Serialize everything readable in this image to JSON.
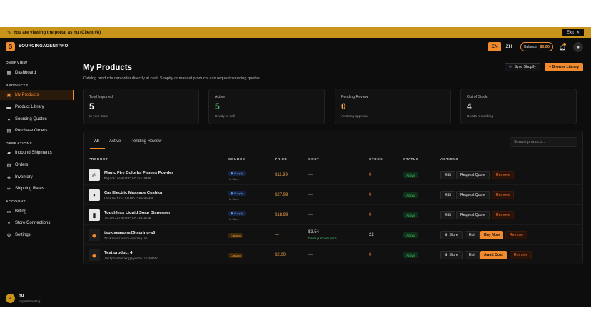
{
  "banner": {
    "text": "You are viewing the portal as hu (Client #8)",
    "exit_label": "Exit"
  },
  "brand": {
    "logo_letter": "S",
    "name": "SOURCINGAGENTPRO"
  },
  "topbar": {
    "lang_en": "EN",
    "lang_zh": "ZH",
    "balance_label": "Balance",
    "balance_value": "$0.00"
  },
  "sidebar": {
    "sections": [
      {
        "label": "OVERVIEW"
      },
      {
        "label": "PRODUCTS"
      },
      {
        "label": "OPERATIONS"
      },
      {
        "label": "ACCOUNT"
      }
    ],
    "items": [
      {
        "label": "Dashboard"
      },
      {
        "label": "My Products"
      },
      {
        "label": "Product Library"
      },
      {
        "label": "Sourcing Quotes"
      },
      {
        "label": "Purchase Orders"
      },
      {
        "label": "Inbound Shipments"
      },
      {
        "label": "Orders"
      },
      {
        "label": "Inventory"
      },
      {
        "label": "Shipping Rates"
      },
      {
        "label": "Billing"
      },
      {
        "label": "Store Connections"
      },
      {
        "label": "Settings"
      }
    ],
    "user": {
      "initial": "✓",
      "name": "hu",
      "role": "Impersonating"
    }
  },
  "page": {
    "title": "My Products",
    "subtitle": "Catalog products can order directly at cost. Shopify or manual products can request sourcing quotes.",
    "sync_label": "Sync Shopify",
    "browse_label": "+ Browse Library"
  },
  "stats": [
    {
      "label": "Total Imported",
      "value": "5",
      "note": "In your store",
      "color": "#ffffff"
    },
    {
      "label": "Active",
      "value": "5",
      "note": "Ready to sell",
      "color": "#4cc36a"
    },
    {
      "label": "Pending Review",
      "value": "0",
      "note": "Awaiting approval",
      "color": "#f2a34a"
    },
    {
      "label": "Out of Stock",
      "value": "4",
      "note": "Needs restocking",
      "color": "#bdbdbd"
    }
  ],
  "tabs": [
    {
      "label": "All"
    },
    {
      "label": "Active"
    },
    {
      "label": "Pending Review"
    }
  ],
  "search": {
    "placeholder": "Search products..."
  },
  "columns": {
    "product": "PRODUCT",
    "source": "SOURCE",
    "price": "PRICE",
    "cost": "COST",
    "stock": "STOCK",
    "status": "STATUS",
    "actions": "ACTIONS"
  },
  "rows": [
    {
      "name": "Magic Fire Colorful Flames Powder",
      "sku": "MagicFire1014052353547840B",
      "source": "Shopify",
      "source_sub": "In Store",
      "price": "$11.99",
      "cost": "—",
      "cost_sub": "",
      "stock": "0",
      "status": "Active",
      "actions": [
        "Edit",
        "Request Quote",
        "Remove"
      ]
    },
    {
      "name": "Car Electric Massage Cushion",
      "sku": "CarElectric101405253049566B",
      "source": "Shopify",
      "source_sub": "In Store",
      "price": "$27.99",
      "cost": "—",
      "cost_sub": "",
      "stock": "0",
      "status": "Active",
      "actions": [
        "Edit",
        "Request Quote",
        "Remove"
      ]
    },
    {
      "name": "Touchless Liquid Soap Dispenser",
      "sku": "Touchless1014052353304853B",
      "source": "Shopify",
      "source_sub": "In Store",
      "price": "$18.99",
      "cost": "—",
      "cost_sub": "",
      "stock": "0",
      "status": "Active",
      "actions": [
        "Edit",
        "Request Quote",
        "Remove"
      ]
    },
    {
      "name": "tsukiseasons26-spring-a5",
      "sku": "tsukiseasons26-spring-a5",
      "source": "Catalog",
      "source_sub": "",
      "price": "—",
      "cost": "$3.54",
      "cost_sub": "Direct purchase price",
      "stock": "22",
      "status": "Active",
      "actions": [
        "Store",
        "Edit",
        "Buy Now",
        "Remove"
      ]
    },
    {
      "name": "Test product 4",
      "sku": "Testpro4mbkSkgjEy4056215709dfc",
      "source": "Catalog",
      "source_sub": "",
      "price": "$2.00",
      "cost": "—",
      "cost_sub": "",
      "stock": "0",
      "status": "Active",
      "actions": [
        "Store",
        "Edit",
        "Await Cost",
        "Remove"
      ]
    }
  ],
  "colors": {
    "accent": "#f28a2e",
    "banner": "#c8941a",
    "active_green": "#4cc36a",
    "stock_zero": "#f2773a"
  }
}
